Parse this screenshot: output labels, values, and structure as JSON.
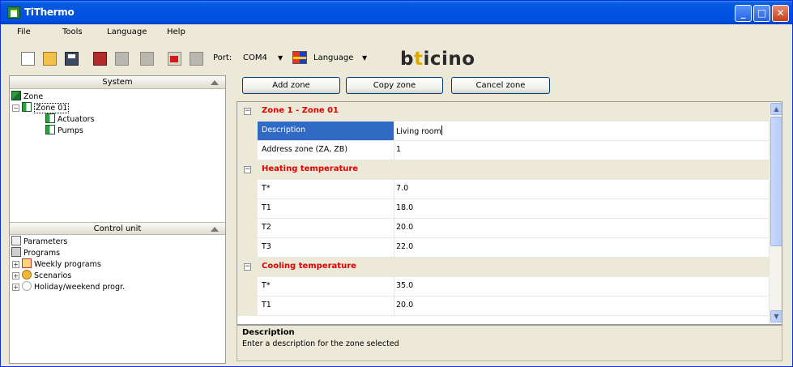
{
  "window": {
    "title": "TiThermo"
  },
  "menu": [
    "File",
    "Tools",
    "Language",
    "Help"
  ],
  "toolbar": {
    "port_label": "Port:",
    "port_value": "COM4",
    "language_label": "Language",
    "brand": "bticino"
  },
  "system_panel": {
    "header": "System",
    "tree": [
      {
        "label": "Zone",
        "icon": "zone-icon"
      },
      {
        "label": "Zone 01",
        "icon": "zone-folder-icon",
        "selected": true
      },
      {
        "label": "Actuators",
        "icon": "actuator-icon"
      },
      {
        "label": "Pumps",
        "icon": "pump-icon"
      }
    ]
  },
  "control_panel": {
    "header": "Control unit",
    "tree": [
      {
        "label": "Parameters",
        "icon": "parameters-icon"
      },
      {
        "label": "Programs",
        "icon": "programs-icon"
      },
      {
        "label": "Weekly programs",
        "icon": "calendar-icon"
      },
      {
        "label": "Scenarios",
        "icon": "scenario-icon"
      },
      {
        "label": "Holiday/weekend progr.",
        "icon": "holiday-icon"
      }
    ]
  },
  "actions": {
    "add_zone": "Add zone",
    "copy_zone": "Copy zone",
    "cancel_zone": "Cancel zone"
  },
  "grid": {
    "sections": [
      {
        "title": "Zone 1 - Zone 01",
        "rows": [
          {
            "name": "Description",
            "value": "Living room",
            "selected": true
          },
          {
            "name": "Address zone (ZA, ZB)",
            "value": "1"
          }
        ]
      },
      {
        "title": "Heating temperature",
        "rows": [
          {
            "name": "T*",
            "value": "7.0"
          },
          {
            "name": "T1",
            "value": "18.0"
          },
          {
            "name": "T2",
            "value": "20.0"
          },
          {
            "name": "T3",
            "value": "22.0"
          }
        ]
      },
      {
        "title": "Cooling temperature",
        "rows": [
          {
            "name": "T*",
            "value": "35.0"
          },
          {
            "name": "T1",
            "value": "20.0"
          }
        ]
      }
    ]
  },
  "description_panel": {
    "title": "Description",
    "text": "Enter a description for the zone selected"
  }
}
